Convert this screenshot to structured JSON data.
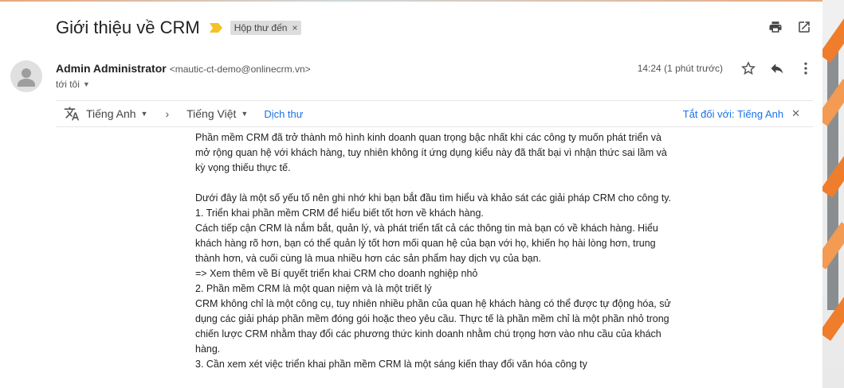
{
  "subject": "Giới thiệu về CRM",
  "label": "Hộp thư đến",
  "label_close": "×",
  "icons": {
    "importance": "importance-marker-icon",
    "print": "print-icon",
    "new_window": "open-in-new-window-icon",
    "avatar": "person-avatar-icon",
    "star": "star-icon",
    "reply": "reply-icon",
    "more": "more-vert-icon",
    "translate": "translate-icon",
    "chevron": "chevron-right-icon",
    "close": "close-icon"
  },
  "sender": {
    "name": "Admin Administrator",
    "email": "<mautic-ct-demo@onlinecrm.vn>",
    "to": "tới tôi"
  },
  "timestamp": "14:24 (1 phút trước)",
  "translate": {
    "source_lang": "Tiếng Anh",
    "target_lang": "Tiếng Việt",
    "translate_link": "Dịch thư",
    "turn_off": "Tắt đối với: Tiếng Anh"
  },
  "body": {
    "p1": "Phần mềm CRM đã trở thành mô hình kinh doanh quan trọng bậc nhất khi các công ty muốn phát triển và mở rộng quan hệ với khách hàng, tuy nhiên không ít ứng dụng kiểu này đã thất bại vì nhận thức sai lầm và kỳ vọng thiếu thực tế.",
    "p2": "Dưới đây là một số yếu tố nên ghi nhớ khi bạn bắt đầu tìm hiểu và khảo sát các giải pháp CRM cho công ty.",
    "p3": "1. Triển khai phần mềm CRM để hiểu biết tốt hơn về khách hàng.",
    "p4": "Cách tiếp cận CRM là nắm bắt, quản lý, và phát triển tất cả các thông tin mà bạn có về khách hàng. Hiểu khách hàng rõ hơn, bạn có thể quản lý tốt hơn mối quan hệ của bạn với họ, khiến họ hài lòng hơn, trung thành hơn, và cuối cùng là mua nhiều hơn các sản phẩm hay dịch vụ của bạn.",
    "p5": "=> Xem thêm về Bí quyết triển khai CRM cho doanh nghiệp nhỏ",
    "p6": "2. Phần mềm CRM là một quan niệm và là một triết lý",
    "p7": "CRM không chỉ là một công cụ, tuy nhiên nhiều phần của quan hệ khách hàng có thể được tự động hóa, sử dụng các giải pháp phần mềm đóng gói hoặc theo yêu cầu. Thực tế là phần mềm chỉ là một phần nhỏ trong chiến lược CRM nhằm thay đổi các phương thức kinh doanh nhằm chú trọng hơn vào nhu cầu của khách hàng.",
    "p8": "3. Cần xem xét việc triển khai phần mềm CRM là một sáng kiến thay đổi văn hóa công ty"
  },
  "colors": {
    "link": "#1a73e8",
    "importance": "#f6c026",
    "chip_bg": "#dddddd"
  }
}
